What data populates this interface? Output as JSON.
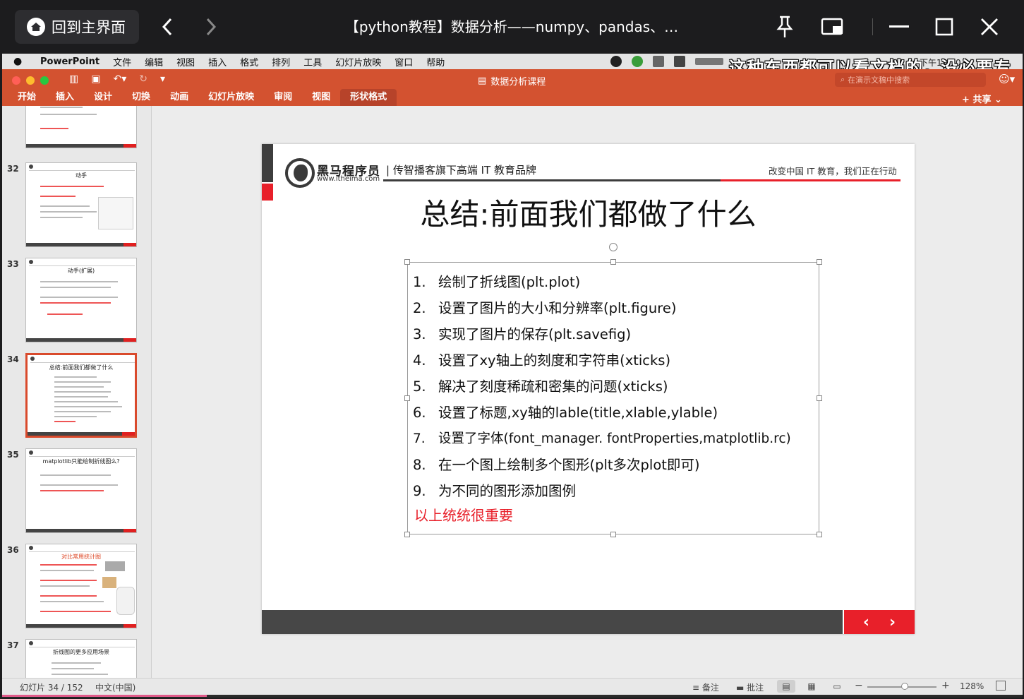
{
  "player": {
    "home_label": "回到主界面",
    "title": "【python教程】数据分析——numpy、pandas、…"
  },
  "mac_menu": {
    "app": "PowerPoint",
    "items": [
      "文件",
      "编辑",
      "视图",
      "插入",
      "格式",
      "排列",
      "工具",
      "幻灯片放映",
      "窗口",
      "帮助"
    ],
    "clock": "下午12:10"
  },
  "subtitle_overlay": "这种东西都可以看文档的，没必要专",
  "ribbon": {
    "doc_title": "数据分析课程",
    "search_placeholder": "在演示文稿中搜索",
    "tabs": [
      "开始",
      "插入",
      "设计",
      "切换",
      "动画",
      "幻灯片放映",
      "审阅",
      "视图",
      "形状格式"
    ],
    "active_tab": "形状格式",
    "share_label": "共享"
  },
  "thumbnails": [
    {
      "num": "",
      "title": ""
    },
    {
      "num": "32",
      "title": "动手"
    },
    {
      "num": "33",
      "title": "动手(扩展)"
    },
    {
      "num": "34",
      "title": "总结:前面我们都做了什么"
    },
    {
      "num": "35",
      "title": "matplotlib只能绘制折线图么?"
    },
    {
      "num": "36",
      "title": "对比常用统计图"
    },
    {
      "num": "37",
      "title": "折线图的更多应用场景"
    }
  ],
  "slide": {
    "brand": "黑马程序员",
    "url": "www.itheima.com",
    "tagline": "| 传智播客旗下高端 IT 教育品牌",
    "slogan": "改变中国 IT 教育，我们正在行动",
    "title": "总结:前面我们都做了什么",
    "items": [
      {
        "n": "1.",
        "text": "绘制了折线图(plt.plot)"
      },
      {
        "n": "2.",
        "text": "设置了图片的大小和分辨率(plt.figure)"
      },
      {
        "n": "3.",
        "text": "实现了图片的保存(plt.savefig)"
      },
      {
        "n": "4.",
        "text": "设置了xy轴上的刻度和字符串(xticks)"
      },
      {
        "n": "5.",
        "text": "解决了刻度稀疏和密集的问题(xticks)"
      },
      {
        "n": "6.",
        "text": "设置了标题,xy轴的lable(title,xlable,ylable)"
      },
      {
        "n": "7.",
        "text": "设置了字体(font_manager. fontProperties,matplotlib.rc)"
      },
      {
        "n": "8.",
        "text": "在一个图上绘制多个图形(plt多次plot即可)"
      },
      {
        "n": "9.",
        "text": "为不同的图形添加图例"
      }
    ],
    "emphasis": "以上统统很重要",
    "nav_prev": "‹",
    "nav_next": "›"
  },
  "status": {
    "slide_counter": "幻灯片 34 / 152",
    "language": "中文(中国)",
    "notes": "备注",
    "comments": "批注",
    "zoom": "128%",
    "zoom_fraction": 0.5
  },
  "colors": {
    "accent": "#d35230",
    "slide_red": "#e8202a",
    "dark": "#474747"
  }
}
